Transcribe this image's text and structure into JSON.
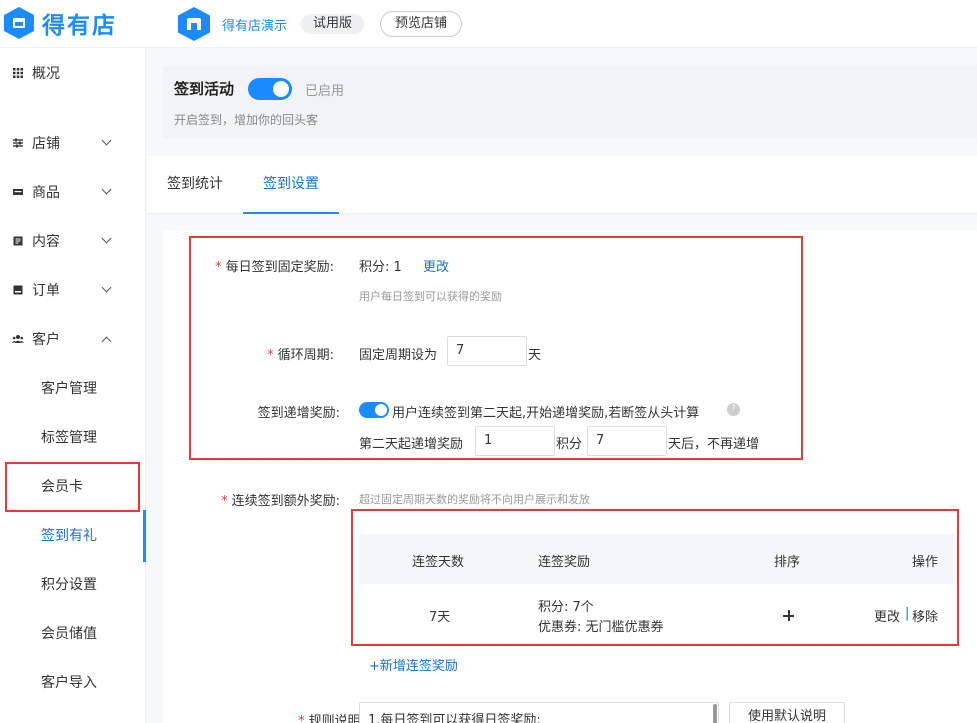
{
  "header": {
    "brand_name": "得有店",
    "store_name": "得有店演示",
    "trial_badge": "试用版",
    "preview_button": "预览店铺"
  },
  "sidebar": {
    "items": [
      {
        "label": "概况",
        "icon": "grid-icon"
      },
      {
        "label": "店铺",
        "icon": "sliders-icon",
        "expanded": false
      },
      {
        "label": "商品",
        "icon": "list-icon",
        "expanded": false
      },
      {
        "label": "内容",
        "icon": "doc-icon",
        "expanded": false
      },
      {
        "label": "订单",
        "icon": "order-icon",
        "expanded": false
      },
      {
        "label": "客户",
        "icon": "users-icon",
        "expanded": true
      }
    ],
    "sub_items": [
      "客户管理",
      "标签管理",
      "会员卡",
      "签到有礼",
      "积分设置",
      "会员储值",
      "客户导入"
    ],
    "active_sub": "签到有礼"
  },
  "activity": {
    "title": "签到活动",
    "status": "已启用",
    "description": "开启签到，增加你的回头客"
  },
  "tabs": [
    {
      "label": "签到统计",
      "active": false
    },
    {
      "label": "签到设置",
      "active": true
    }
  ],
  "form": {
    "daily_reward": {
      "label": "每日签到固定奖励:",
      "value_text": "积分: 1",
      "edit_link": "更改",
      "hint": "用户每日签到可以获得的奖励"
    },
    "cycle": {
      "label": "循环周期:",
      "prefix": "固定周期设为",
      "value": "7",
      "suffix": "天"
    },
    "increment": {
      "label": "签到递增奖励:",
      "toggle_text": "用户连续签到第二天起,开始递增奖励,若断签从头计算",
      "help_icon": "?",
      "prefix": "第二天起递增奖励",
      "value": "1",
      "mid": "积分",
      "days_value": "7",
      "suffix": "天后，不再递增"
    },
    "extra": {
      "label": "连续签到额外奖励:",
      "hint": "超过固定周期天数的奖励将不向用户展示和发放",
      "columns": [
        "连签天数",
        "连签奖励",
        "排序",
        "操作"
      ],
      "rows": [
        {
          "days": "7天",
          "reward_points": "积分:  7个",
          "reward_coupon": "优惠券:  无门槛优惠券",
          "edit": "更改",
          "separator": "|",
          "remove": "移除"
        }
      ],
      "add_link": "+新增连签奖励"
    },
    "rules": {
      "label": "规则说明:",
      "text": "1.每日签到可以获得日签奖励;",
      "default_button": "使用默认说明"
    }
  }
}
